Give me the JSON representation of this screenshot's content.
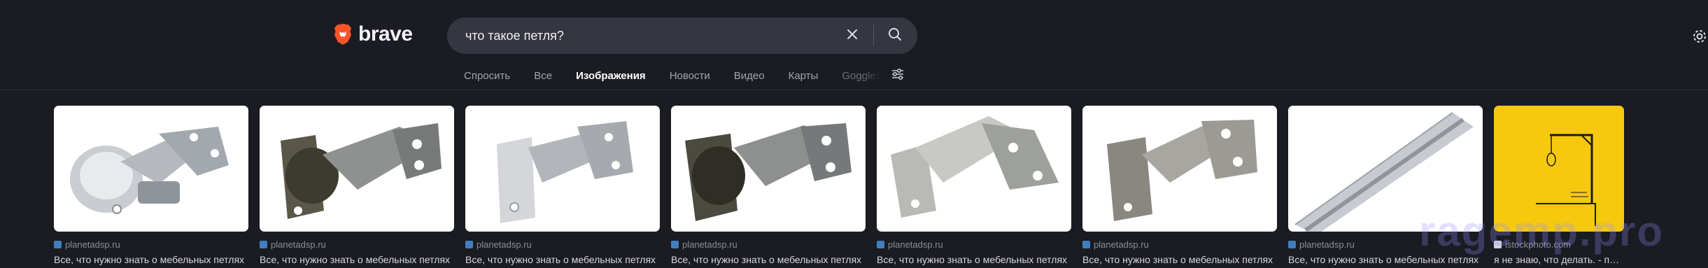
{
  "brand": {
    "name": "brave"
  },
  "search": {
    "query": "что такое петля?",
    "placeholder": ""
  },
  "tabs": [
    {
      "label": "Спросить"
    },
    {
      "label": "Все"
    },
    {
      "label": "Изображения"
    },
    {
      "label": "Новости"
    },
    {
      "label": "Видео"
    },
    {
      "label": "Карты"
    },
    {
      "label": "Goggles"
    }
  ],
  "active_tab": "Изображения",
  "results": [
    {
      "source": "planetadsp.ru",
      "caption": "Все, что нужно знать о мебельных петлях"
    },
    {
      "source": "planetadsp.ru",
      "caption": "Все, что нужно знать о мебельных петлях"
    },
    {
      "source": "planetadsp.ru",
      "caption": "Все, что нужно знать о мебельных петлях"
    },
    {
      "source": "planetadsp.ru",
      "caption": "Все, что нужно знать о мебельных петлях"
    },
    {
      "source": "planetadsp.ru",
      "caption": "Все, что нужно знать о мебельных петлях"
    },
    {
      "source": "planetadsp.ru",
      "caption": "Все, что нужно знать о мебельных петлях"
    },
    {
      "source": "planetadsp.ru",
      "caption": "Все, что нужно знать о мебельных петлях"
    },
    {
      "source": "istockphoto.com",
      "caption": "я не знаю, что делать. - петл..."
    }
  ],
  "watermark": "ragemp.pro",
  "icons": {
    "logo": "brave-lion-icon",
    "clear": "close-icon",
    "search": "search-icon",
    "filters": "sliders-icon",
    "settings": "gear-icon"
  },
  "colors": {
    "background": "#1b1b22",
    "search_box": "#353640",
    "brand_orange": "#fb542b",
    "gallows_yellow": "#f6c90e"
  }
}
